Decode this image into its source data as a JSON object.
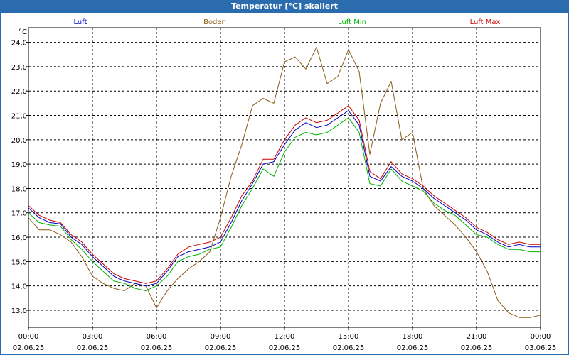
{
  "window": {
    "title": "Temperatur [°C] skaliert"
  },
  "chart_data": {
    "type": "line",
    "title": "Temperatur [°C] skaliert",
    "ylabel": "°C",
    "xlabel": "",
    "ylim": [
      12.3,
      24.6
    ],
    "xlim": [
      0,
      24
    ],
    "grid": true,
    "legend_position": "top",
    "yticks": [
      "24,0",
      "23,0",
      "22,0",
      "21,0",
      "20,0",
      "19,0",
      "18,0",
      "17,0",
      "16,0",
      "15,0",
      "14,0",
      "13,0"
    ],
    "ytick_values": [
      24,
      23,
      22,
      21,
      20,
      19,
      18,
      17,
      16,
      15,
      14,
      13
    ],
    "xticks": [
      {
        "time": "00:00",
        "date": "02.06.25",
        "hour": 0
      },
      {
        "time": "03:00",
        "date": "02.06.25",
        "hour": 3
      },
      {
        "time": "06:00",
        "date": "02.06.25",
        "hour": 6
      },
      {
        "time": "09:00",
        "date": "02.06.25",
        "hour": 9
      },
      {
        "time": "12:00",
        "date": "02.06.25",
        "hour": 12
      },
      {
        "time": "15:00",
        "date": "02.06.25",
        "hour": 15
      },
      {
        "time": "18:00",
        "date": "02.06.25",
        "hour": 18
      },
      {
        "time": "21:00",
        "date": "02.06.25",
        "hour": 21
      },
      {
        "time": "00:00",
        "date": "03.06.25",
        "hour": 24
      }
    ],
    "series": [
      {
        "name": "Luft",
        "color": "#0000c8",
        "x": [
          0,
          0.5,
          1,
          1.5,
          2,
          2.5,
          3,
          3.5,
          4,
          4.5,
          5,
          5.5,
          6,
          6.5,
          7,
          7.5,
          8,
          8.5,
          9,
          9.5,
          10,
          10.5,
          11,
          11.5,
          12,
          12.5,
          13,
          13.5,
          14,
          14.5,
          15,
          15.5,
          16,
          16.5,
          17,
          17.5,
          18,
          18.5,
          19,
          19.5,
          20,
          20.5,
          21,
          21.5,
          22,
          22.5,
          23,
          23.5,
          24
        ],
        "values": [
          17.2,
          16.8,
          16.6,
          16.55,
          16.0,
          15.7,
          15.2,
          14.8,
          14.4,
          14.2,
          14.1,
          14.0,
          14.1,
          14.6,
          15.2,
          15.4,
          15.5,
          15.6,
          15.8,
          16.6,
          17.5,
          18.2,
          19.0,
          19.1,
          19.8,
          20.4,
          20.7,
          20.5,
          20.6,
          20.9,
          21.2,
          20.6,
          18.5,
          18.3,
          18.9,
          18.5,
          18.3,
          18.0,
          17.6,
          17.3,
          17.0,
          16.7,
          16.3,
          16.1,
          15.8,
          15.6,
          15.7,
          15.6,
          15.6
        ]
      },
      {
        "name": "Boden",
        "color": "#8b5a14",
        "x": [
          0,
          0.5,
          1,
          1.5,
          2,
          2.5,
          3,
          3.5,
          4,
          4.5,
          5,
          5.5,
          6,
          6.5,
          7,
          7.5,
          8,
          8.5,
          9,
          9.5,
          10,
          10.5,
          11,
          11.5,
          12,
          12.5,
          13,
          13.5,
          14,
          14.5,
          15,
          15.5,
          16,
          16.5,
          17,
          17.5,
          18,
          18.5,
          19,
          19.5,
          20,
          20.5,
          21,
          21.5,
          22,
          22.5,
          23,
          23.5,
          24
        ],
        "values": [
          16.8,
          16.3,
          16.3,
          16.1,
          15.8,
          15.2,
          14.4,
          14.1,
          13.9,
          13.8,
          14.1,
          14.0,
          13.1,
          13.8,
          14.3,
          14.7,
          15.0,
          15.4,
          16.8,
          18.5,
          19.8,
          21.4,
          21.7,
          21.5,
          23.2,
          23.4,
          22.9,
          23.8,
          22.3,
          22.6,
          23.7,
          22.8,
          19.4,
          21.5,
          22.4,
          20.0,
          20.3,
          18.0,
          17.3,
          16.9,
          16.5,
          16.0,
          15.4,
          14.6,
          13.4,
          12.9,
          12.7,
          12.7,
          12.8
        ]
      },
      {
        "name": "Luft Min",
        "color": "#00b400",
        "x": [
          0,
          0.5,
          1,
          1.5,
          2,
          2.5,
          3,
          3.5,
          4,
          4.5,
          5,
          5.5,
          6,
          6.5,
          7,
          7.5,
          8,
          8.5,
          9,
          9.5,
          10,
          10.5,
          11,
          11.5,
          12,
          12.5,
          13,
          13.5,
          14,
          14.5,
          15,
          15.5,
          16,
          16.5,
          17,
          17.5,
          18,
          18.5,
          19,
          19.5,
          20,
          20.5,
          21,
          21.5,
          22,
          22.5,
          23,
          23.5,
          24
        ],
        "values": [
          17.0,
          16.6,
          16.5,
          16.45,
          15.9,
          15.5,
          15.0,
          14.6,
          14.2,
          14.1,
          13.9,
          13.8,
          14.0,
          14.4,
          15.0,
          15.2,
          15.3,
          15.5,
          15.6,
          16.4,
          17.3,
          18.0,
          18.8,
          18.5,
          19.5,
          20.1,
          20.3,
          20.2,
          20.3,
          20.6,
          20.9,
          20.3,
          18.2,
          18.1,
          18.8,
          18.3,
          18.1,
          17.9,
          17.4,
          17.1,
          16.9,
          16.5,
          16.1,
          16.0,
          15.7,
          15.5,
          15.5,
          15.4,
          15.4
        ]
      },
      {
        "name": "Luft Max",
        "color": "#c80000",
        "x": [
          0,
          0.5,
          1,
          1.5,
          2,
          2.5,
          3,
          3.5,
          4,
          4.5,
          5,
          5.5,
          6,
          6.5,
          7,
          7.5,
          8,
          8.5,
          9,
          9.5,
          10,
          10.5,
          11,
          11.5,
          12,
          12.5,
          13,
          13.5,
          14,
          14.5,
          15,
          15.5,
          16,
          16.5,
          17,
          17.5,
          18,
          18.5,
          19,
          19.5,
          20,
          20.5,
          21,
          21.5,
          22,
          22.5,
          23,
          23.5,
          24
        ],
        "values": [
          17.3,
          16.9,
          16.7,
          16.6,
          16.1,
          15.8,
          15.3,
          14.9,
          14.5,
          14.3,
          14.2,
          14.1,
          14.2,
          14.7,
          15.3,
          15.6,
          15.7,
          15.8,
          16.0,
          16.8,
          17.7,
          18.3,
          19.2,
          19.2,
          20.0,
          20.6,
          20.9,
          20.7,
          20.8,
          21.1,
          21.4,
          20.8,
          18.7,
          18.4,
          19.1,
          18.6,
          18.4,
          18.1,
          17.7,
          17.4,
          17.1,
          16.8,
          16.4,
          16.2,
          15.9,
          15.7,
          15.8,
          15.7,
          15.7
        ]
      }
    ]
  }
}
